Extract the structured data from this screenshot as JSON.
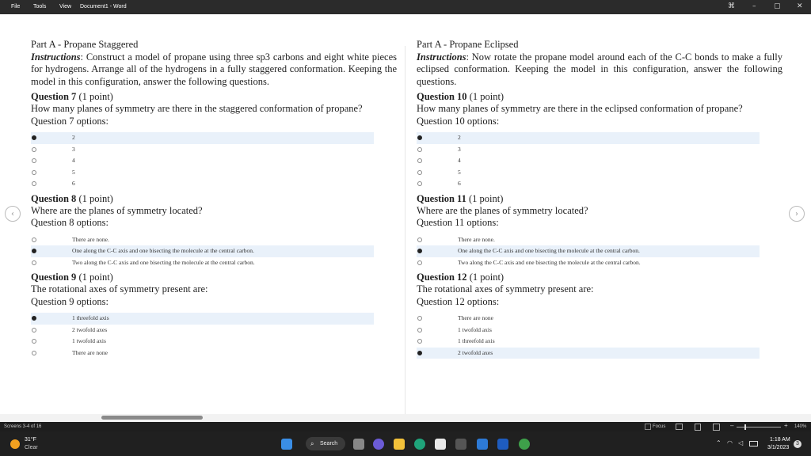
{
  "topbar": {
    "menu": [
      "File",
      "Tools",
      "View"
    ],
    "doc_title": "Document1 - Word",
    "controls": {
      "focus": "⌘",
      "minimize": "–",
      "restore": "▢",
      "close": "✕"
    }
  },
  "left": {
    "part_title": "Part A - Propane Staggered",
    "instructions_label": "Instructions",
    "instructions_text": ": Construct a model of propane using three sp3 carbons and eight white pieces for hydrogens. Arrange all of the hydrogens in a fully staggered conformation. Keeping the model in this configuration, answer the following questions.",
    "questions": [
      {
        "label": "Question 7",
        "points": " (1 point)",
        "text": "How many planes of symmetry are there in the staggered conformation of propane?",
        "options_label": "Question 7 options:",
        "options": [
          "2",
          "3",
          "4",
          "5",
          "6"
        ],
        "selected": 0
      },
      {
        "label": "Question 8",
        "points": " (1 point)",
        "text": "Where are the planes of symmetry located?",
        "options_label": "Question 8 options:",
        "options": [
          "There are none.",
          "One along the C-C axis and one bisecting the molecule at the central carbon.",
          "Two along the C-C axis and one bisecting the molecule at the central carbon."
        ],
        "selected": 1
      },
      {
        "label": "Question 9",
        "points": " (1 point)",
        "text": "The rotational axes of symmetry present are:",
        "options_label": "Question 9 options:",
        "options": [
          "1 threefold axis",
          "2 twofold axes",
          "1 twofold axis",
          "There are none"
        ],
        "selected": 0
      }
    ]
  },
  "right": {
    "part_title": "Part A - Propane Eclipsed",
    "instructions_label": "Instructions",
    "instructions_text": ": Now rotate the propane model around each of the C-C bonds to make a fully eclipsed conformation.  Keeping the model in this configuration, answer the following questions.",
    "questions": [
      {
        "label": "Question 10",
        "points": " (1 point)",
        "text": "How many planes of symmetry are there in the eclipsed conformation of propane?",
        "options_label": "Question 10 options:",
        "options": [
          "2",
          "3",
          "4",
          "5",
          "6"
        ],
        "selected": 0
      },
      {
        "label": "Question 11",
        "points": " (1 point)",
        "text": "Where are the planes of symmetry located?",
        "options_label": "Question 11 options:",
        "options": [
          "There are none.",
          "One along the C-C axis and one bisecting the molecule at the central carbon.",
          "Two along the C-C axis and one bisecting the molecule at the central carbon."
        ],
        "selected": 1
      },
      {
        "label": "Question 12",
        "points": " (1 point)",
        "text": "The rotational axes of symmetry present are:",
        "options_label": "Question 12 options:",
        "options": [
          "There are none",
          "1 twofold axis",
          "1 threefold axis",
          "2 twofold axes"
        ],
        "selected": 3
      }
    ]
  },
  "nav": {
    "prev": "‹",
    "next": "›"
  },
  "status": {
    "screens": "Screens 3-4 of 16",
    "focus": "Focus",
    "zoom": "140%"
  },
  "taskbar": {
    "weather_temp": "31°F",
    "weather_desc": "Clear",
    "search": "Search",
    "time": "1:18 AM",
    "date": "3/1/2023",
    "notif_count": "3"
  },
  "colors": {
    "selected_bg": "#e9f1fa",
    "taskbar": "#202020",
    "titlebar": "#2b2b2b"
  }
}
